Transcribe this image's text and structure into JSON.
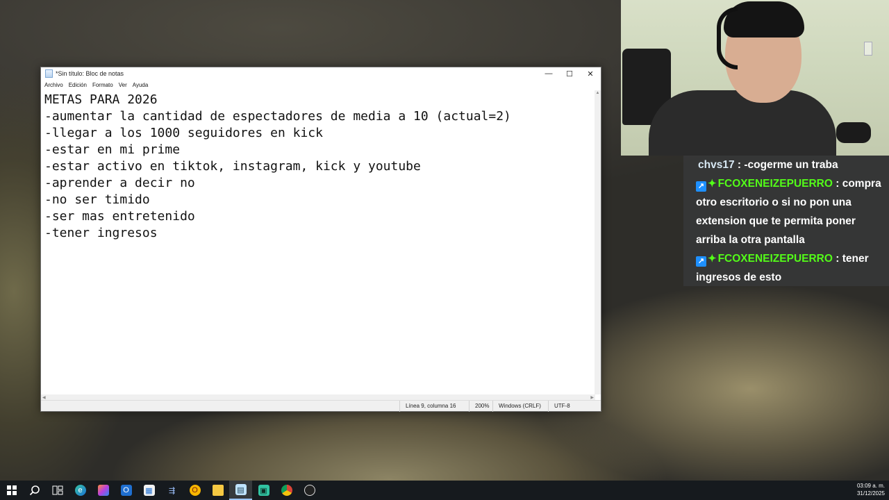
{
  "notepad": {
    "title": "*Sin título: Bloc de notas",
    "menu": [
      "Archivo",
      "Edición",
      "Formato",
      "Ver",
      "Ayuda"
    ],
    "controls": {
      "minimize": "—",
      "maximize": "☐",
      "close": "✕"
    },
    "content_lines": [
      "METAS PARA 2026",
      "-aumentar la cantidad de espectadores de media a 10 (actual=2)",
      "-llegar a los 1000 seguidores en kick",
      "-estar en mi prime",
      "-estar activo en tiktok, instagram, kick y youtube",
      "-aprender a decir no",
      "-no ser timido",
      "-ser mas entretenido",
      "-tener ingresos"
    ],
    "status": {
      "position": "Línea 9, columna 16",
      "zoom": "200%",
      "line_ending": "Windows (CRLF)",
      "encoding": "UTF-8"
    }
  },
  "chat": {
    "messages": [
      {
        "user": "chvs17",
        "text": " : -cogerme un traba",
        "badges": false
      },
      {
        "user": "FCOXENEIZEPUERRO",
        "text": " : compra otro escritorio o si no pon una extension que te permita poner arriba la otra pantalla",
        "badges": true
      },
      {
        "user": "FCOXENEIZEPUERRO",
        "text": " : tener ingresos de esto",
        "badges": true
      }
    ],
    "colors": {
      "plain_user": "#d7e8f3",
      "badge_user": "#53fc18",
      "badge_box": "#1e90ff"
    }
  },
  "taskbar": {
    "icons": [
      "windows-start-icon",
      "search-icon",
      "task-view-icon",
      "edge-icon",
      "copilot-icon",
      "outlook-icon",
      "store-icon",
      "remote-desktop-icon",
      "opera-gx-icon",
      "file-explorer-icon",
      "notepad-icon",
      "streamlabs-icon",
      "chrome-icon",
      "obs-icon"
    ],
    "time": "03:09 a. m.",
    "date": "31/12/2025"
  }
}
